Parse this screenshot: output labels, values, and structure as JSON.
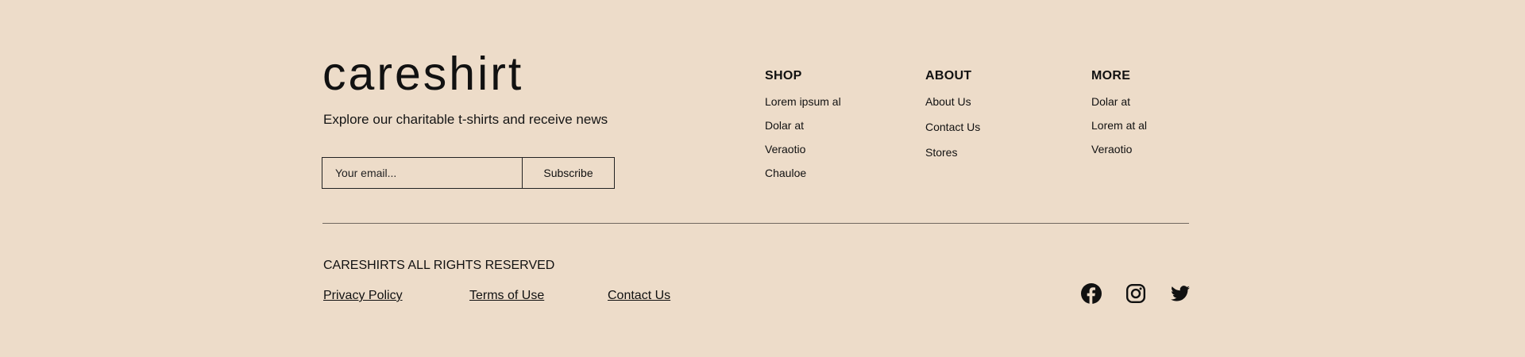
{
  "brand": {
    "name": "careshirt",
    "tagline": "Explore our charitable t-shirts and receive news"
  },
  "subscribe": {
    "email_placeholder": "Your email...",
    "button_label": "Subscribe"
  },
  "columns": [
    {
      "heading": "SHOP",
      "items": [
        "Lorem ipsum al",
        "Dolar at",
        "Veraotio",
        "Chauloe"
      ]
    },
    {
      "heading": "ABOUT",
      "items": [
        "About Us",
        "Contact Us",
        "Stores"
      ]
    },
    {
      "heading": "MORE",
      "items": [
        "Dolar at",
        "Lorem at al",
        "Veraotio"
      ]
    }
  ],
  "bottom": {
    "rights": "CARESHIRTS ALL RIGHTS RESERVED",
    "links": [
      "Privacy Policy",
      "Terms of Use",
      "Contact Us"
    ]
  },
  "social": [
    "facebook-icon",
    "instagram-icon",
    "twitter-icon"
  ],
  "colors": {
    "background": "#eddcc9",
    "text": "#111111",
    "divider": "#6f665e"
  }
}
